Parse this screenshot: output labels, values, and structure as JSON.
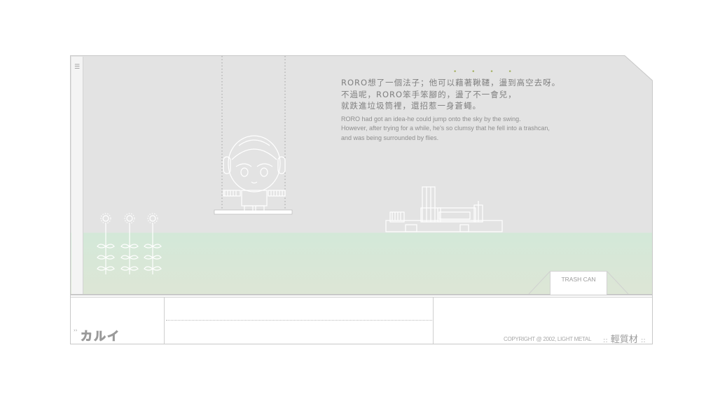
{
  "story": {
    "zh_lines": [
      "RORO想了一個法子；他可以藉著鞦韆，盪到高空去呀。",
      "不過呢，RORO笨手笨腳的，盪了不一會兒，",
      "就跌進垃圾筒裡，還招惹一身蒼蠅。"
    ],
    "en_lines": [
      "RORO had got an idea-he could jump onto the sky by the swing.",
      "However, after trying for a while, he's so clumsy that he fell into a trashcan,",
      "and was being surrounded by flies."
    ],
    "dots": "• • • •"
  },
  "trash_can": {
    "label": "TRASH CAN"
  },
  "footer": {
    "copyright": "COPYRIGHT @ 2002, LIGHT METAL",
    "brand": "輕質材",
    "brand_prefix": "::",
    "brand_suffix": "::",
    "logo_text": "カルイ"
  },
  "colors": {
    "sky": "#e3e3e3",
    "grass": "#d3e8d8",
    "line_art": "#ffffff",
    "text": "#808080",
    "accent_dots": "#a8b36a"
  }
}
